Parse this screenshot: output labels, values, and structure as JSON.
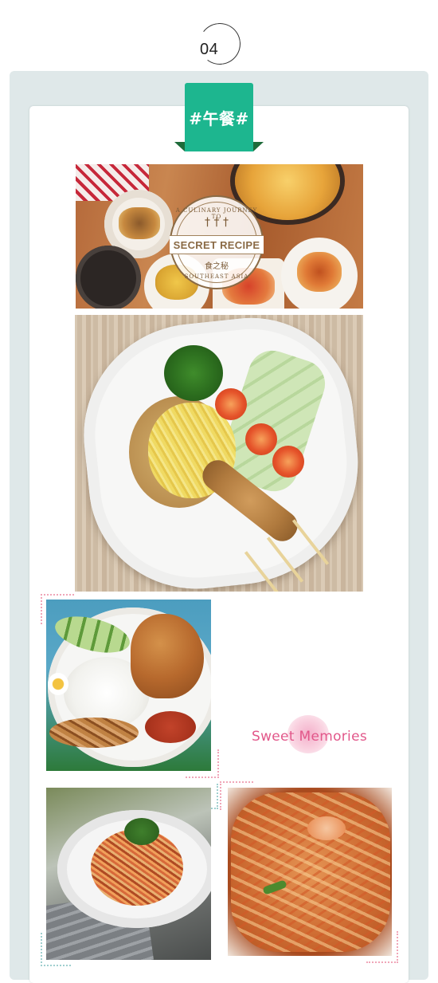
{
  "section": {
    "number": "04"
  },
  "tag": {
    "label": "#午餐#"
  },
  "photos": [
    {
      "name": "restaurant-spread-photo",
      "logo": {
        "arc_top": "A CULINARY JOURNEY TO",
        "brand": "SECRET RECIPE",
        "cn_name": "食之秘",
        "arc_bottom": "SOUTHEAST ASIA"
      }
    },
    {
      "name": "nasi-goreng-photo"
    },
    {
      "name": "chicken-rice-photo"
    },
    {
      "name": "spaghetti-photo"
    },
    {
      "name": "char-kway-teow-photo"
    }
  ],
  "caption": {
    "text": "Sweet Memories"
  },
  "colors": {
    "panel_bg": "#dfe8e9",
    "tag_green": "#1db68f",
    "tag_fold": "#1e6b3a",
    "caption_pink": "#e2578a"
  }
}
